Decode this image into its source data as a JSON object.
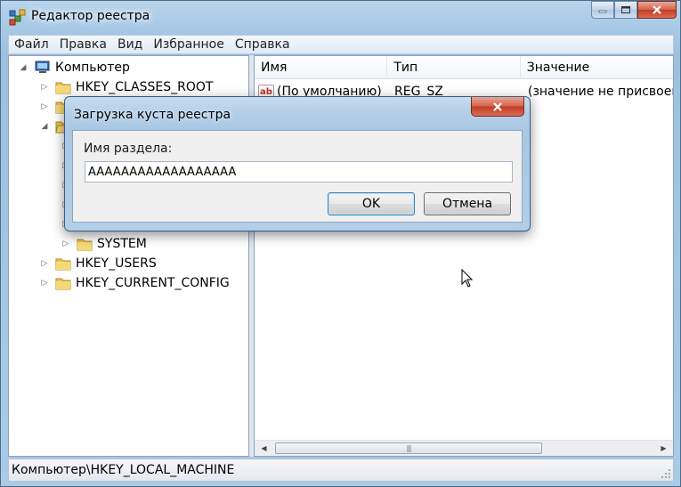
{
  "window": {
    "title": "Редактор реестра"
  },
  "menu": [
    "Файл",
    "Правка",
    "Вид",
    "Избранное",
    "Справка"
  ],
  "tree": {
    "root": "Компьютер",
    "items": [
      {
        "label": "HKEY_CLASSES_ROOT",
        "level": 1,
        "expanded": false
      },
      {
        "label": "SYSTEM",
        "level": 2,
        "expanded": false
      },
      {
        "label": "HKEY_USERS",
        "level": 1,
        "expanded": false
      },
      {
        "label": "HKEY_CURRENT_CONFIG",
        "level": 1,
        "expanded": false
      }
    ]
  },
  "list": {
    "columns": [
      "Имя",
      "Тип",
      "Значение"
    ],
    "rows": [
      {
        "name": "(По умолчанию)",
        "type": "REG_SZ",
        "value": "(значение не присвоено)",
        "icon": "ab"
      }
    ]
  },
  "statusbar": {
    "path": "Компьютер\\HKEY_LOCAL_MACHINE"
  },
  "dialog": {
    "title": "Загрузка куста реестра",
    "field_label": "Имя раздела:",
    "field_value": "AAAAAAAAAAAAAAAAAA",
    "ok_label": "OK",
    "cancel_label": "Отмена"
  },
  "colors": {
    "accent": "#3c7fb1",
    "close_button": "#c43a23"
  }
}
